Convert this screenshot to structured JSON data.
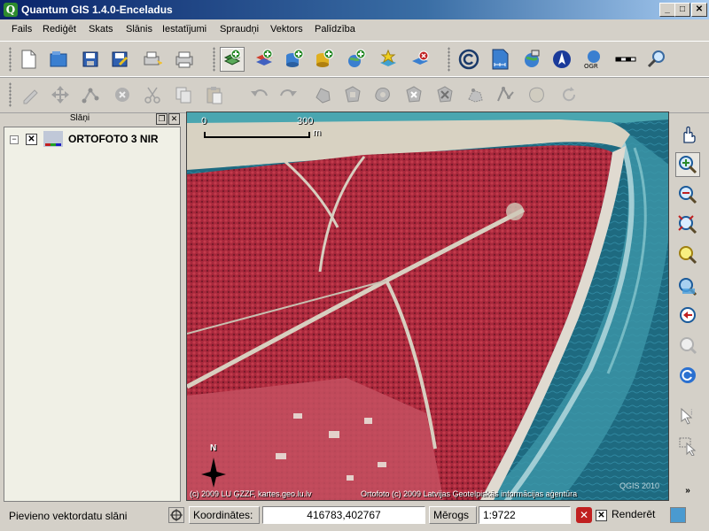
{
  "window": {
    "title": "Quantum GIS 1.4.0-Enceladus",
    "app_icon": "Q"
  },
  "menu": [
    "Fails",
    "Rediģēt",
    "Skats",
    "Slānis",
    "Iestatījumi",
    "Spraudņi",
    "Vektors",
    "Palīdzība"
  ],
  "toolbar_file": [
    "new-project-icon",
    "open-project-icon",
    "save-project-icon",
    "save-as-icon",
    "print-composer-icon",
    "print-icon"
  ],
  "toolbar_layers": [
    "add-vector-layer-icon",
    "add-raster-layer-icon",
    "add-postgis-layer-icon",
    "add-spatialite-layer-icon",
    "add-wms-layer-icon",
    "new-vector-layer-icon",
    "remove-layer-icon"
  ],
  "toolbar_plugins": [
    "copyright-icon",
    "north-arrow-icon",
    "gps-icon",
    "compass-icon",
    "ogr-converter-icon",
    "scale-bar-icon",
    "search-icon"
  ],
  "toolbar_digitizing": [
    "toggle-edit-icon",
    "move-feature-icon",
    "node-tool-icon",
    "delete-feature-icon",
    "cut-icon",
    "copy-icon",
    "paste-icon",
    "undo-icon",
    "redo-icon",
    "simplify-icon",
    "add-ring-icon",
    "add-island-icon",
    "delete-ring-icon",
    "delete-part-icon",
    "reshape-icon",
    "split-icon",
    "merge-icon",
    "node-merge-icon",
    "rotate-icon"
  ],
  "panel": {
    "title": "Slāņi"
  },
  "layers": [
    {
      "name": "ORTOFOTO 3 NIR",
      "checked": true
    }
  ],
  "map": {
    "scale_bar": {
      "start": "0",
      "end": "300",
      "unit": "m"
    },
    "north_label": "N",
    "attribution_left": "(c) 2009 LU ĢZZF, kartes.geo.lu.lv",
    "attribution_right": "Ortofoto (c) 2009 Latvijas Ģeotelpiskās informācijas aģentūra",
    "watermark": "QGIS 2010",
    "colors": {
      "forest": "#a8283c",
      "sea": "#1e6a80",
      "beach": "#d8d2c2",
      "surf": "#4aa6b0"
    }
  },
  "right_toolbar": [
    "pan-icon",
    "zoom-in-icon",
    "zoom-out-icon",
    "zoom-full-icon",
    "zoom-layer-icon",
    "zoom-selection-icon",
    "zoom-last-icon",
    "zoom-next-icon",
    "refresh-icon",
    "identify-icon",
    "select-icon"
  ],
  "status": {
    "message": "Pievieno vektordatu slāni",
    "coord_label": "Koordinātes:",
    "coord_value": "416783,402767",
    "scale_label": "Mērogs",
    "scale_value": "1:9722",
    "render_label": "Renderēt",
    "render_checked": true
  }
}
